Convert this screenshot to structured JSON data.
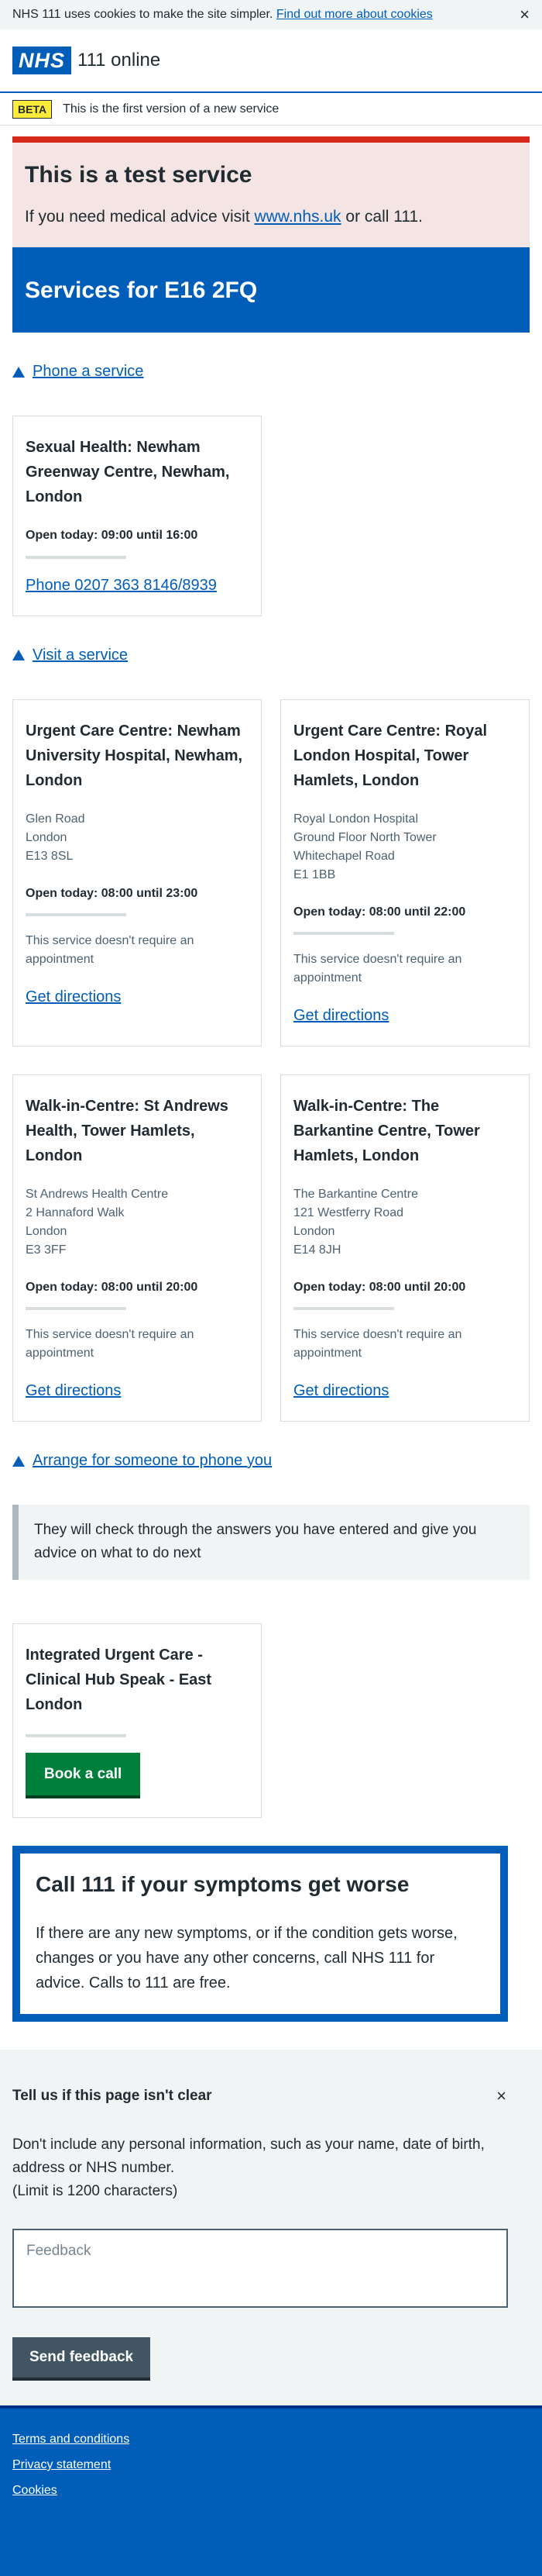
{
  "cookie": {
    "text": "NHS 111 uses cookies to make the site simpler.",
    "link": "Find out more about cookies",
    "close": "×"
  },
  "header": {
    "logo": "NHS",
    "service": "111 online"
  },
  "beta": {
    "tag": "BETA",
    "text": "This is the first version of a new service"
  },
  "test_banner": {
    "title": "This is a test service",
    "prefix": "If you need medical advice visit",
    "link": "www.nhs.uk",
    "suffix": "or call 111."
  },
  "services_title": "Services for E16 2FQ",
  "phone_section": {
    "toggle": "Phone a service",
    "card": {
      "title": "Sexual Health: Newham Greenway Centre, Newham, London",
      "open": "Open today: 09:00 until 16:00",
      "link": "Phone 0207 363 8146/8939"
    }
  },
  "visit_section": {
    "toggle": "Visit a service",
    "cards": [
      {
        "title": "Urgent Care Centre: Newham University Hospital, Newham, London",
        "address": [
          "Glen Road",
          "London",
          "E13 8SL"
        ],
        "open": "Open today: 08:00 until 23:00",
        "note": "This service doesn't require an appointment",
        "link": "Get directions"
      },
      {
        "title": "Urgent Care Centre: Royal London Hospital, Tower Hamlets, London",
        "address": [
          "Royal London Hospital",
          "Ground Floor North Tower",
          "Whitechapel Road",
          "E1 1BB"
        ],
        "open": "Open today: 08:00 until 22:00",
        "note": "This service doesn't require an appointment",
        "link": "Get directions"
      },
      {
        "title": "Walk-in-Centre: St Andrews Health, Tower Hamlets, London",
        "address": [
          "St Andrews Health Centre",
          "2 Hannaford Walk",
          "London",
          "E3 3FF"
        ],
        "open": "Open today: 08:00 until 20:00",
        "note": "This service doesn't require an appointment",
        "link": "Get directions"
      },
      {
        "title": "Walk-in-Centre: The Barkantine Centre, Tower Hamlets, London",
        "address": [
          "The Barkantine Centre",
          "121 Westferry Road",
          "London",
          "E14 8JH"
        ],
        "open": "Open today: 08:00 until 20:00",
        "note": "This service doesn't require an appointment",
        "link": "Get directions"
      }
    ]
  },
  "callback_section": {
    "toggle": "Arrange for someone to phone you",
    "inset": "They will check through the answers you have entered and give you advice on what to do next",
    "card": {
      "title": "Integrated Urgent Care - Clinical Hub Speak - East London",
      "button": "Book a call"
    }
  },
  "care_card": {
    "title": "Call 111 if your symptoms get worse",
    "text": "If there are any new symptoms, or if the condition gets worse, changes or you have any other concerns, call NHS 111 for advice. Calls to 111 are free."
  },
  "feedback": {
    "title": "Tell us if this page isn't clear",
    "close": "×",
    "privacy": "Don't include any personal information, such as your name, date of birth, address or NHS number.",
    "limit": "(Limit is 1200 characters)",
    "placeholder": "Feedback",
    "button": "Send feedback"
  },
  "footer": {
    "links": [
      "Terms and conditions",
      "Privacy statement",
      "Cookies"
    ]
  },
  "colors": {
    "nhs_blue": "#005eb8",
    "test_red": "#d5281b",
    "test_bg": "#f4e4e3",
    "green": "#007f3b",
    "grey_button": "#425563",
    "beta_yellow": "#ffeb3b"
  }
}
